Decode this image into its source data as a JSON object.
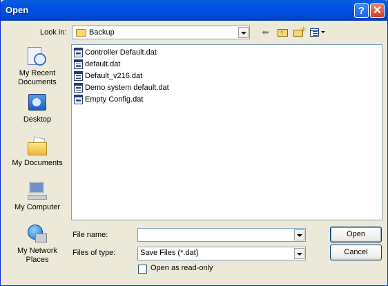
{
  "window": {
    "title": "Open",
    "help_label": "?",
    "close_label": "✕"
  },
  "toolbar": {
    "look_in_label": "Look in:",
    "look_in_value": "Backup",
    "icons": [
      "back-arrow-icon",
      "up-one-level-icon",
      "new-folder-icon",
      "view-menu-icon"
    ]
  },
  "places": [
    {
      "label": "My Recent Documents",
      "icon": "recent-documents-icon"
    },
    {
      "label": "Desktop",
      "icon": "desktop-icon"
    },
    {
      "label": "My Documents",
      "icon": "my-documents-icon"
    },
    {
      "label": "My Computer",
      "icon": "my-computer-icon"
    },
    {
      "label": "My Network Places",
      "icon": "network-places-icon"
    }
  ],
  "files": [
    {
      "name": "Controller Default.dat",
      "icon": "dat-file-icon"
    },
    {
      "name": "default.dat",
      "icon": "dat-file-icon"
    },
    {
      "name": "Default_v216.dat",
      "icon": "dat-file-icon"
    },
    {
      "name": "Demo system default.dat",
      "icon": "dat-file-icon"
    },
    {
      "name": "Empty Config.dat",
      "icon": "dat-file-icon"
    }
  ],
  "form": {
    "file_name_label": "File name:",
    "file_name_value": "",
    "file_type_label": "Files of type:",
    "file_type_value": "Save Files (*.dat)",
    "read_only_label": "Open as read-only",
    "read_only_checked": false
  },
  "buttons": {
    "open": "Open",
    "cancel": "Cancel"
  },
  "colors": {
    "titlebar": "#0054e3",
    "face": "#ece9d8",
    "field_border": "#7f9db9"
  }
}
